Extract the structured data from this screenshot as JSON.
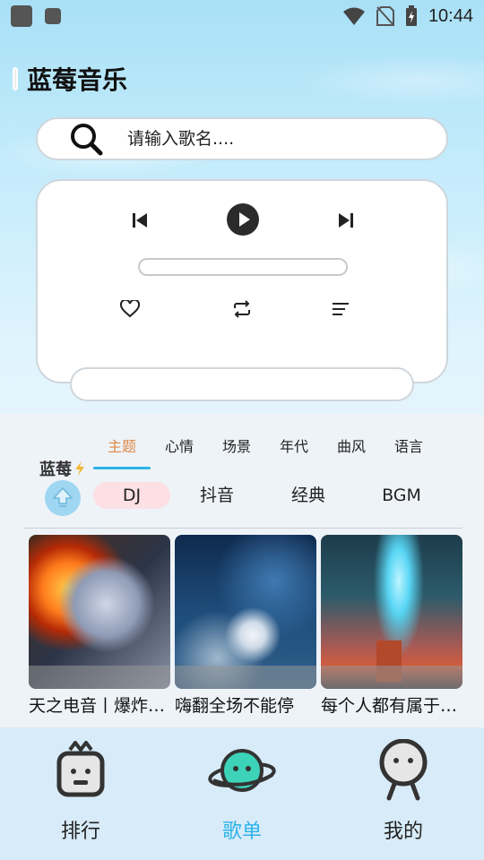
{
  "status_bar": {
    "time": "10:44"
  },
  "app": {
    "title": "蓝莓音乐"
  },
  "search": {
    "placeholder": "请输入歌名...."
  },
  "player": {
    "lyric": "",
    "progress": 0
  },
  "brand": {
    "name": "蓝莓"
  },
  "category_tabs": [
    "主题",
    "心情",
    "场景",
    "年代",
    "曲风",
    "语言"
  ],
  "active_tab": "主题",
  "chips": [
    "DJ",
    "抖音",
    "经典",
    "BGM"
  ],
  "active_chip": "DJ",
  "playlists": [
    {
      "title": "天之电音丨爆炸…"
    },
    {
      "title": "嗨翻全场不能停"
    },
    {
      "title": "每个人都有属于…"
    }
  ],
  "bottom_nav": [
    {
      "label": "排行",
      "icon": "ranking-robot-icon"
    },
    {
      "label": "歌单",
      "icon": "playlist-planet-icon"
    },
    {
      "label": "我的",
      "icon": "profile-person-icon"
    }
  ],
  "active_nav": "歌单",
  "colors": {
    "accent": "#2db3e8",
    "active_tab": "#e0894a",
    "chip_bg": "#fde0e4"
  }
}
